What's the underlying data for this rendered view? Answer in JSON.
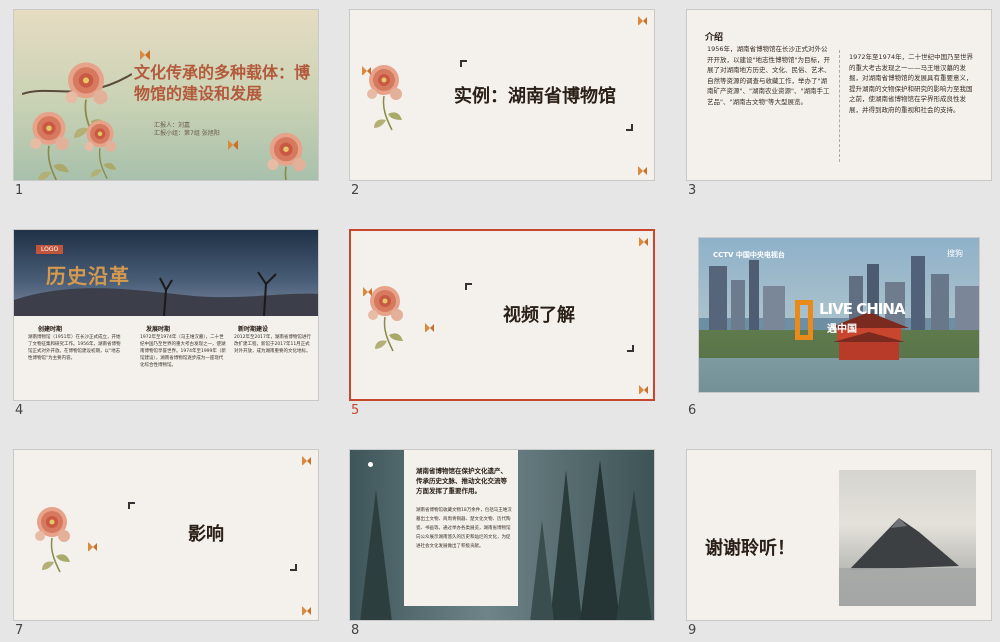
{
  "slides": [
    {
      "number": "1",
      "title": "文化传承的多种载体：博物馆的建设和发展",
      "presenter": "汇报人：刘嘉",
      "group": "汇报小组：第7组 张旭阳"
    },
    {
      "number": "2",
      "title": "实例：湖南省博物馆"
    },
    {
      "number": "3",
      "heading": "介绍",
      "left_text": "1956年，湖南省博物馆在长沙正式对外公开开放，以建设\"地志性博物馆\"为目标，开展了对湖南地方历史、文化、民俗、艺术、自然等资源的调查与收藏工作，举办了\"湖南矿产资源\"、\"湖南农业资源\"、\"湖南手工艺品\"、\"湖南古文物\"等大型展览。",
      "right_text": "1972年至1974年，二十世纪中国乃至世界的重大考古发现之一——马王堆汉墓的发掘，对湖南省博物馆的发展具有重要意义，提升湖南的文物保护和研究的影响力至我国之前，使湖南省博物馆在学界形成良性发展，并得到政府的重视和社会的支持。"
    },
    {
      "number": "4",
      "logo": "LOGO",
      "banner_title": "历史沿革",
      "columns": [
        {
          "heading": "创建时期",
          "text": "湖南博物馆（1951年）在长沙正式成立，开始了文物征集和研究工作。1956年，湖南省博物馆正式对外开放。在博物馆建设初期，以\"地志性博物馆\"为主要内容。"
        },
        {
          "heading": "发展时期",
          "text": "1972年至1974年（马王堆汉墓），二十世纪中国乃至世界的重大考古发现之一，使湖南博物馆享誉世界。1974年至1999年（新馆建设），湖南省博物馆逐步成为一座现代化综合性博物馆。"
        },
        {
          "heading": "新时期建设",
          "text": "2012年至2017年，湖南省博物馆进行改扩建工程，新馆于2017年11月正式对外开放，成为湖南重要的文化地标。"
        }
      ]
    },
    {
      "number": "5",
      "title": "视频了解"
    },
    {
      "number": "6",
      "cctv": "CCTV 中国中央电视台",
      "watermark": "搜狗",
      "video_title": "LIVE CHINA",
      "video_sub": "遇中国"
    },
    {
      "number": "7",
      "title": "影响"
    },
    {
      "number": "8",
      "panel_title": "湖南省博物馆在保护文化遗产、传承历史文脉、推动文化交流等方面发挥了重要作用。",
      "panel_text": "湖南省博物馆收藏文物18万余件，包括马王堆汉墓出土文物、商周青铜器、楚文化文物、历代陶瓷、书画等。通过举办各类展览，湖南省博物馆向公众展示湖南悠久的历史和灿烂的文化，为促进社会文化发展做出了积极贡献。"
    },
    {
      "number": "9",
      "title": "谢谢聆听！"
    }
  ],
  "selected_slide": "5",
  "colors": {
    "accent": "#c8462c",
    "background": "#e6e6e6",
    "slide_bg": "#f4f1ec"
  }
}
